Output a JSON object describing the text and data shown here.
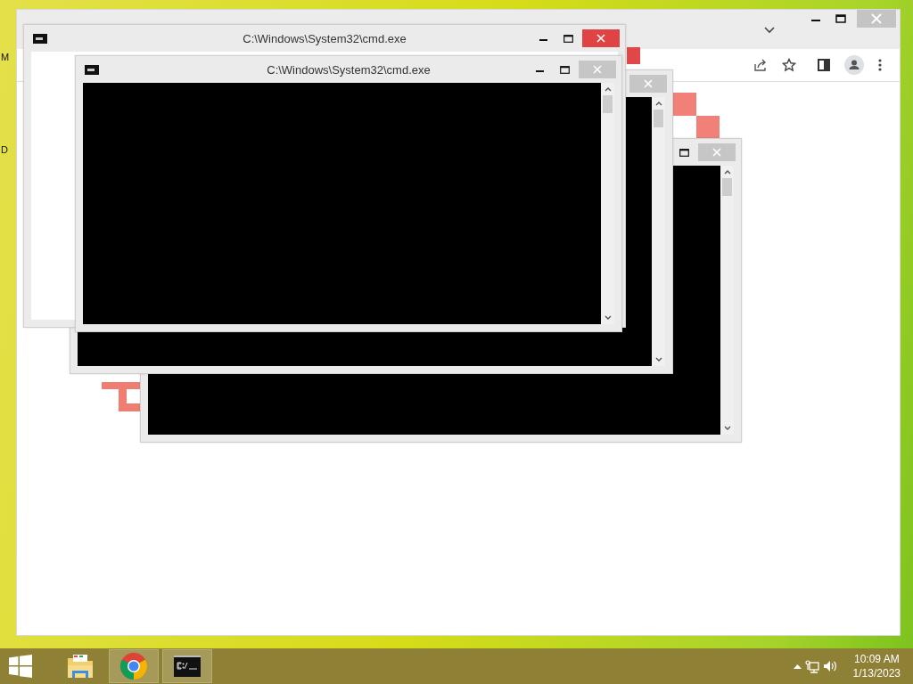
{
  "desktop": {
    "icon_labels": [
      {
        "text": "M"
      },
      {
        "text": "D"
      }
    ]
  },
  "console_windows": [
    {
      "active": false,
      "buttons": [
        {
          "kind": "maximize"
        },
        {
          "kind": "close"
        }
      ],
      "kind": "console"
    },
    {
      "active": false,
      "buttons": [
        {
          "kind": "close"
        }
      ],
      "kind": "console"
    },
    {
      "title": "C:\\Windows\\System32\\cmd.exe",
      "active": true,
      "buttons": [
        {
          "kind": "minimize"
        },
        {
          "kind": "maximize"
        },
        {
          "kind": "close"
        }
      ],
      "kind": "blank"
    },
    {
      "title": "C:\\Windows\\System32\\cmd.exe",
      "active": false,
      "buttons": [
        {
          "kind": "minimize"
        },
        {
          "kind": "maximize"
        },
        {
          "kind": "close"
        }
      ],
      "kind": "console"
    }
  ],
  "taskbar": {
    "items": [
      {
        "kind": "explorer",
        "running": false
      },
      {
        "kind": "chrome",
        "running": true
      },
      {
        "kind": "cmd",
        "running": true
      }
    ],
    "clock": {
      "time": "10:09 AM",
      "date": "1/13/2023"
    }
  }
}
